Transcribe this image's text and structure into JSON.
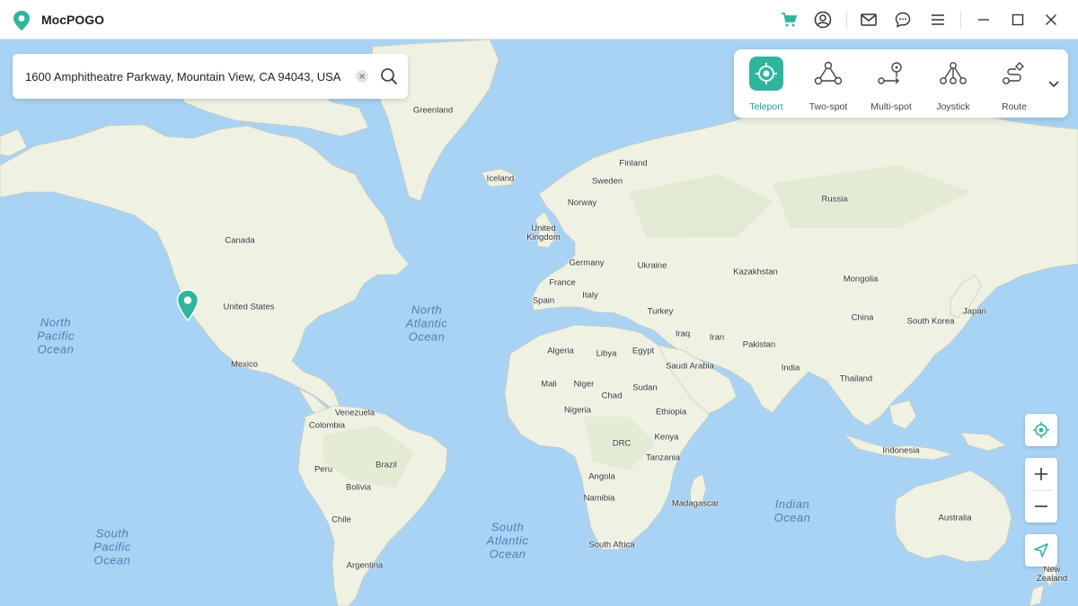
{
  "app": {
    "title": "MocPOGO"
  },
  "colors": {
    "accent": "#2fb59e",
    "land": "#eef0e0",
    "water": "#a9d3f4"
  },
  "titlebar": {
    "icons": [
      "cart-icon",
      "account-icon",
      "mail-icon",
      "feedback-icon",
      "menu-icon",
      "minimize-icon",
      "maximize-icon",
      "close-icon"
    ]
  },
  "search": {
    "value": "1600 Amphitheatre Parkway, Mountain View, CA 94043, USA",
    "placeholder": ""
  },
  "modes": [
    {
      "label": "Teleport",
      "icon": "teleport-icon",
      "active": true
    },
    {
      "label": "Two-spot",
      "icon": "two-spot-icon",
      "active": false
    },
    {
      "label": "Multi-spot",
      "icon": "multi-spot-icon",
      "active": false
    },
    {
      "label": "Joystick",
      "icon": "joystick-icon",
      "active": false
    },
    {
      "label": "Route",
      "icon": "route-icon",
      "active": false
    }
  ],
  "map": {
    "countries": [
      "Greenland",
      "Iceland",
      "Finland",
      "Sweden",
      "Norway",
      "United Kingdom",
      "Germany",
      "Ukraine",
      "France",
      "Italy",
      "Spain",
      "Turkey",
      "Canada",
      "United States",
      "Mexico",
      "Venezuela",
      "Colombia",
      "Brazil",
      "Peru",
      "Bolivia",
      "Chile",
      "Argentina",
      "Algeria",
      "Libya",
      "Egypt",
      "Mali",
      "Niger",
      "Chad",
      "Sudan",
      "Nigeria",
      "Ethiopia",
      "DRC",
      "Kenya",
      "Tanzania",
      "Angola",
      "Namibia",
      "Madagascar",
      "South Africa",
      "Saudi Arabia",
      "Iraq",
      "Iran",
      "Pakistan",
      "India",
      "Thailand",
      "Kazakhstan",
      "Russia",
      "Mongolia",
      "China",
      "South Korea",
      "Japan",
      "Indonesia",
      "Australia",
      "New Zealand"
    ],
    "oceans": {
      "north_pacific": [
        "North",
        "Pacific",
        "Ocean"
      ],
      "north_atlantic": [
        "North",
        "Atlantic",
        "Ocean"
      ],
      "south_pacific": [
        "South",
        "Pacific",
        "Ocean"
      ],
      "south_atlantic": [
        "South",
        "Atlantic",
        "Ocean"
      ],
      "indian": [
        "Indian",
        "Ocean"
      ]
    }
  },
  "controls": [
    "locate-icon",
    "zoom-in-icon",
    "zoom-out-icon",
    "navigate-icon"
  ]
}
